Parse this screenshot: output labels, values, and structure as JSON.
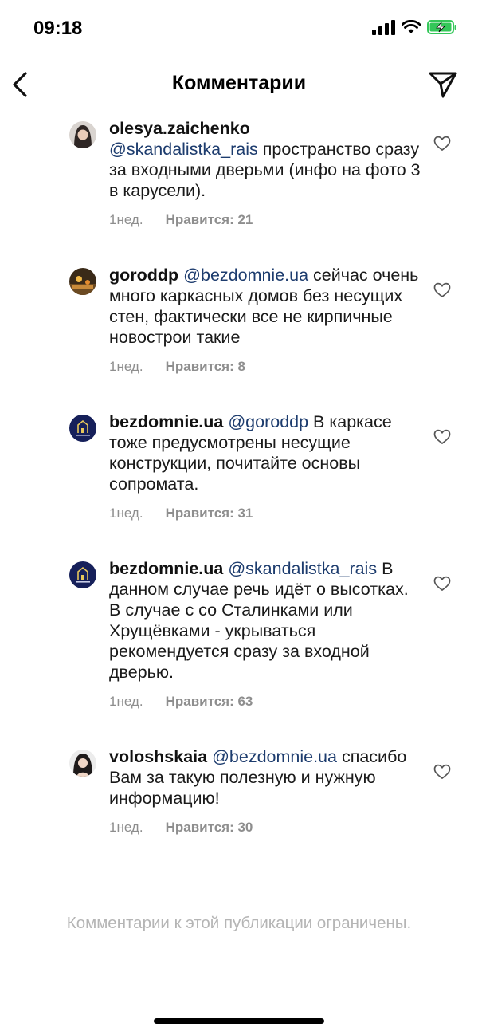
{
  "status_bar": {
    "time": "09:18",
    "battery_color": "#34c759"
  },
  "nav": {
    "title": "Комментарии",
    "back_icon": "chevron-left-icon",
    "share_icon": "paper-plane-icon"
  },
  "comments": [
    {
      "username": "olesya.zaichenko",
      "mention": "",
      "reply_to_line": "@skandalistka_rais",
      "text": " пространство сразу за входными дверьми (инфо на фото 3 в карусели).",
      "time": "1нед.",
      "likes": "Нравится: 21",
      "avatar_color": "#3b3030"
    },
    {
      "username": "goroddp",
      "mention": "@bezdomnie.ua",
      "reply_to_line": "",
      "text": " сейчас очень много каркасных домов без несущих стен, фактически все не кирпичные новострои такие",
      "time": "1нед.",
      "likes": "Нравится: 8",
      "avatar_color": "#5a3b1a"
    },
    {
      "username": "bezdomnie.ua",
      "mention": "@goroddp",
      "reply_to_line": "",
      "text": " В каркасе тоже предусмотрены несущие конструкции, почитайте основы сопромата.",
      "time": "1нед.",
      "likes": "Нравится: 31",
      "avatar_color": "#16205a"
    },
    {
      "username": "bezdomnie.ua",
      "mention": "@skandalistka_rais",
      "reply_to_line": "",
      "text": " В данном случае речь идёт о высотках. В случае с со Сталинками или Хрущёвками - укрываться рекомендуется сразу за входной дверью.",
      "time": "1нед.",
      "likes": "Нравится: 63",
      "avatar_color": "#16205a"
    },
    {
      "username": "voloshskaia",
      "mention": "@bezdomnie.ua",
      "reply_to_line": "",
      "text": " спасибо Вам за такую полезную и нужную информацию!",
      "time": "1нед.",
      "likes": "Нравится: 30",
      "avatar_color": "#dcdcdc"
    }
  ],
  "footer": {
    "restricted_text": "Комментарии к этой публикации ограничены."
  }
}
